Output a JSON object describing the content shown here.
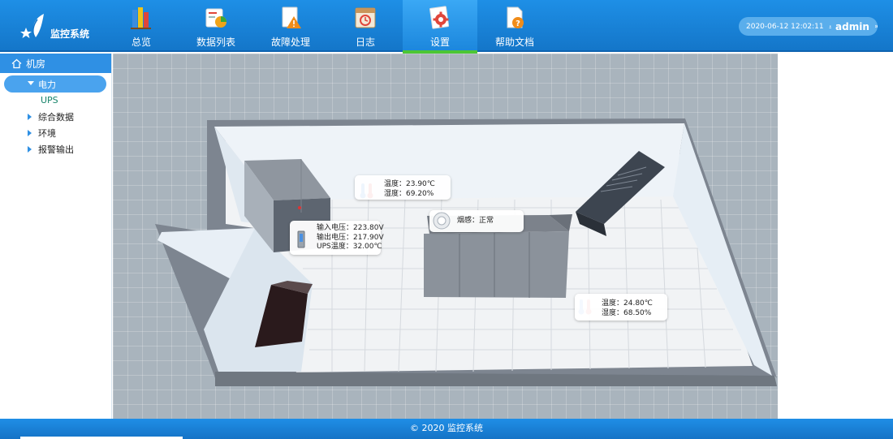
{
  "app": {
    "title": "监控系统"
  },
  "nav": [
    {
      "label": "总览",
      "icon": "book-chart-icon",
      "active": false
    },
    {
      "label": "数据列表",
      "icon": "data-report-icon",
      "active": false
    },
    {
      "label": "故障处理",
      "icon": "warning-document-icon",
      "active": false
    },
    {
      "label": "日志",
      "icon": "calendar-log-icon",
      "active": false
    },
    {
      "label": "设置",
      "icon": "gear-document-icon",
      "active": true
    },
    {
      "label": "帮助文档",
      "icon": "help-document-icon",
      "active": false
    }
  ],
  "header": {
    "datetime": "2020-06-12  12:02:11",
    "username": "admin"
  },
  "sidebar": {
    "root": "机房",
    "group": "电力",
    "leaf": "UPS",
    "items": [
      "综合数据",
      "环境",
      "报警输出"
    ]
  },
  "scene": {
    "sensor1": {
      "temp": "温度：23.90℃",
      "humidity": "湿度：69.20%"
    },
    "ups": {
      "in_voltage": "输入电压：223.80V",
      "out_voltage": "输出电压：217.90V",
      "ups_temp": "UPS温度：32.00℃"
    },
    "smoke": {
      "status": "烟感：正常"
    },
    "sensor2": {
      "temp": "温度：24.80℃",
      "humidity": "湿度：68.50%"
    }
  },
  "footer": {
    "text": "© 2020  监控系统"
  },
  "colors": {
    "header": "#1476c9",
    "accent": "#4cc634",
    "leaf": "#17846a"
  }
}
